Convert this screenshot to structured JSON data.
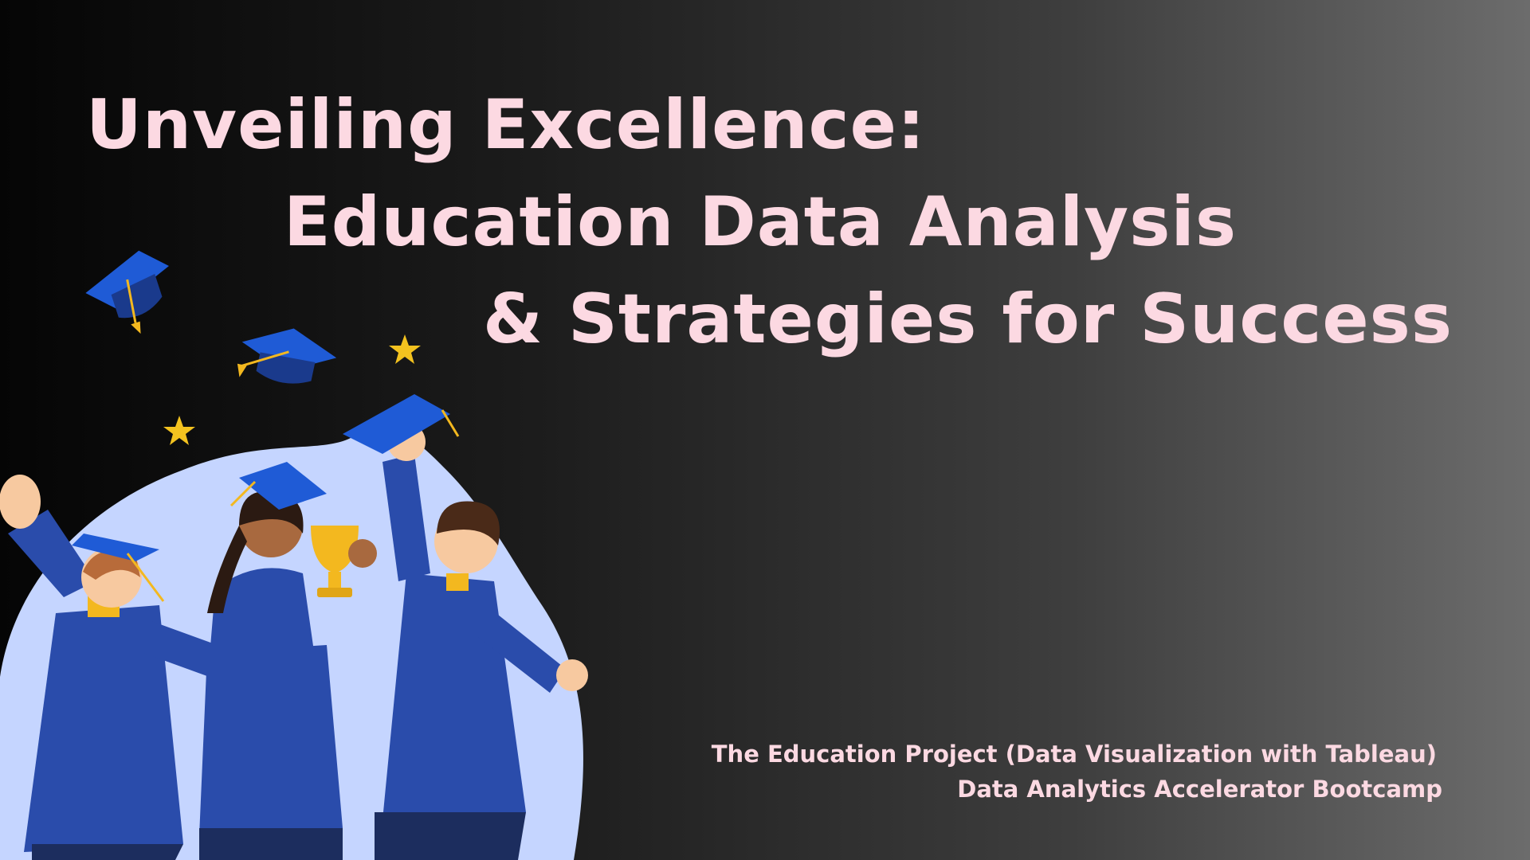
{
  "slide": {
    "title_lines": [
      "Unveiling Excellence:",
      "Education Data Analysis",
      "& Strategies for Success"
    ],
    "subtitle_lines": [
      "The Education Project (Data Visualization with Tableau)",
      "Data Analytics Accelerator Bootcamp"
    ]
  },
  "colors": {
    "title_text": "#fcd9e2",
    "gown_blue": "#2a4cab",
    "backdrop_blob": "#c5d5ff",
    "accent_gold": "#f3b81f",
    "background_left": "#050505",
    "background_right": "#6c6c6c"
  },
  "illustration": {
    "description_icon": "graduates-celebrating-illustration",
    "elements": [
      "graduation-cap-icon",
      "star-icon",
      "trophy-icon",
      "graduate-figure"
    ]
  }
}
